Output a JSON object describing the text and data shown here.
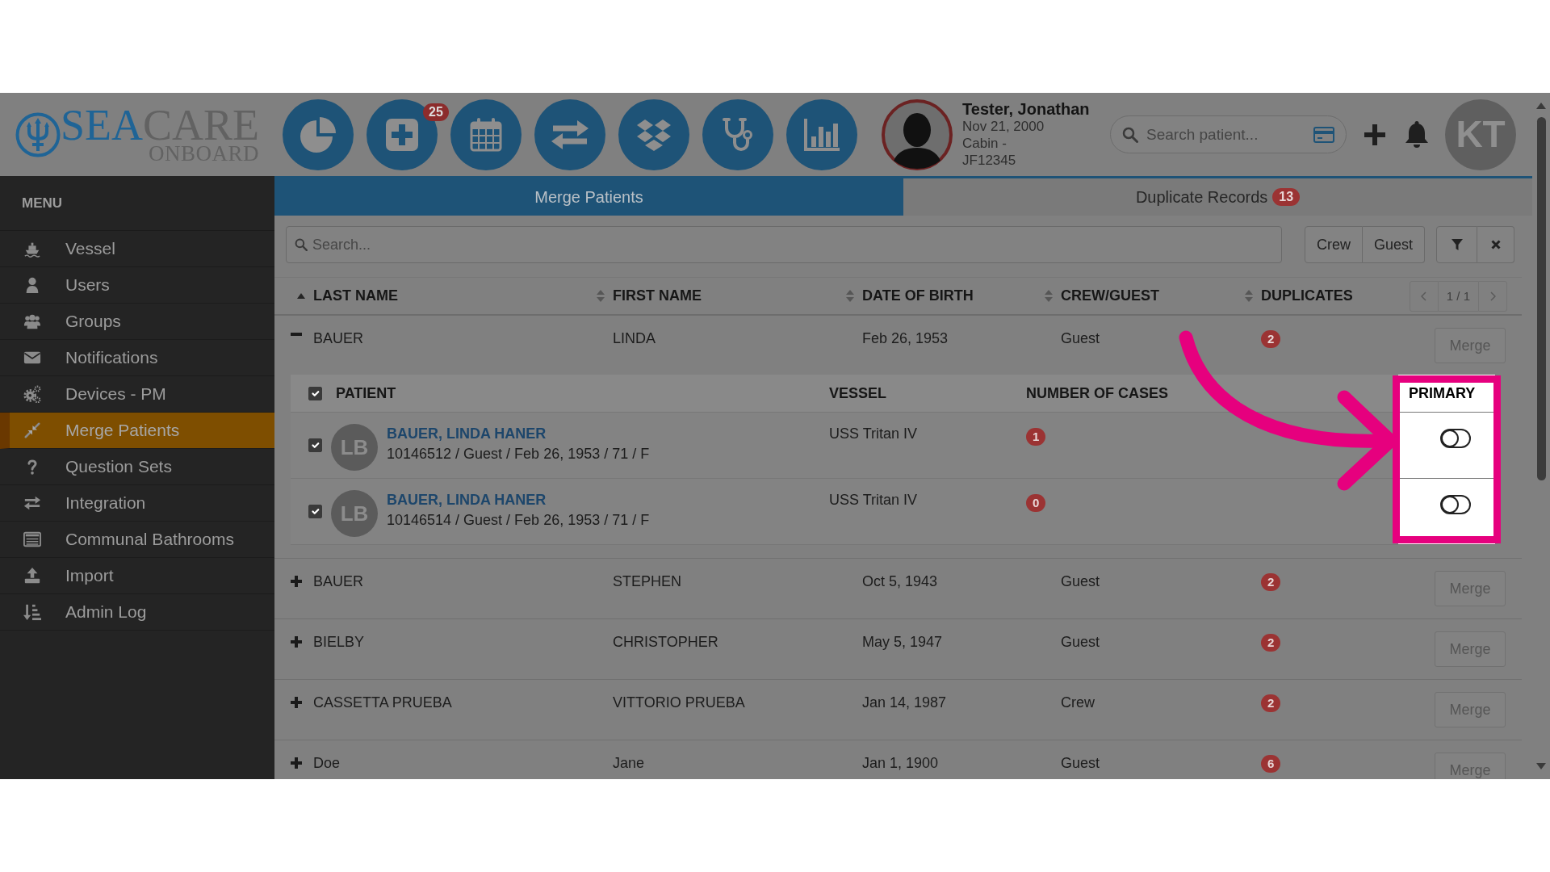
{
  "logo": {
    "parts": [
      {
        "text": "SEA",
        "color": "#1f6496"
      },
      {
        "text": "CARE",
        "color": "#626262"
      }
    ],
    "tagline": "ONBOARD"
  },
  "header": {
    "nav_badge": "25",
    "patient": {
      "name": "Tester, Jonathan",
      "dob": "Nov 21, 2000",
      "cabin": "Cabin -",
      "id": "JF12345"
    },
    "patient_search": {
      "placeholder": "Search patient..."
    },
    "user_initials": "KT"
  },
  "sidebar": {
    "title": "MENU",
    "items": [
      {
        "label": "Vessel",
        "selected": false
      },
      {
        "label": "Users",
        "selected": false
      },
      {
        "label": "Groups",
        "selected": false
      },
      {
        "label": "Notifications",
        "selected": false
      },
      {
        "label": "Devices - PM",
        "selected": false
      },
      {
        "label": "Merge Patients",
        "selected": true
      },
      {
        "label": "Question Sets",
        "selected": false
      },
      {
        "label": "Integration",
        "selected": false
      },
      {
        "label": "Communal Bathrooms",
        "selected": false
      },
      {
        "label": "Import",
        "selected": false
      },
      {
        "label": "Admin Log",
        "selected": false
      }
    ]
  },
  "tabs": [
    {
      "label": "Merge Patients",
      "selected": true
    },
    {
      "label": "Duplicate Records",
      "badge": "13",
      "selected": false
    }
  ],
  "search": {
    "placeholder": "Search..."
  },
  "filters": [
    {
      "label": "Crew",
      "selected": false
    },
    {
      "label": "Guest",
      "selected": false
    }
  ],
  "table": {
    "columns": [
      {
        "label": "LAST NAME",
        "sorted": true
      },
      {
        "label": "FIRST NAME",
        "sorted": false
      },
      {
        "label": "DATE OF BIRTH",
        "sorted": false
      },
      {
        "label": "CREW/GUEST",
        "sorted": false
      },
      {
        "label": "DUPLICATES",
        "sorted": false
      }
    ],
    "pagination": "1 / 1",
    "rows": [
      {
        "last_name": "BAUER",
        "first_name": "LINDA",
        "date_of_birth": "Feb 26, 1953",
        "crew_guest": "Guest",
        "duplicates": "2",
        "expanded": true,
        "action": "Merge",
        "details": {
          "all_checked": true,
          "columns": [
            {
              "label": "PATIENT",
              "highlighted": false
            },
            {
              "label": "VESSEL",
              "highlighted": false
            },
            {
              "label": "NUMBER OF CASES",
              "highlighted": false
            },
            {
              "label": "PRIMARY",
              "highlighted": true
            }
          ],
          "records": [
            {
              "initials": "LB",
              "name": "BAUER, LINDA HANER",
              "summary": "10146512 / Guest / Feb 26, 1953 / 71 / F",
              "vessel": "USS Tritan IV",
              "cases": "1",
              "checked": true,
              "primary": false
            },
            {
              "initials": "LB",
              "name": "BAUER, LINDA HANER",
              "summary": "10146514 / Guest / Feb 26, 1953 / 71 / F",
              "vessel": "USS Tritan IV",
              "cases": "0",
              "checked": true,
              "primary": false
            }
          ]
        }
      },
      {
        "last_name": "BAUER",
        "first_name": "STEPHEN",
        "date_of_birth": "Oct 5, 1943",
        "crew_guest": "Guest",
        "duplicates": "2",
        "expanded": false,
        "action": "Merge"
      },
      {
        "last_name": "BIELBY",
        "first_name": "CHRISTOPHER",
        "date_of_birth": "May 5, 1947",
        "crew_guest": "Guest",
        "duplicates": "2",
        "expanded": false,
        "action": "Merge"
      },
      {
        "last_name": "CASSETTA PRUEBA",
        "first_name": "VITTORIO PRUEBA",
        "date_of_birth": "Jan 14, 1987",
        "crew_guest": "Crew",
        "duplicates": "2",
        "expanded": false,
        "action": "Merge"
      },
      {
        "last_name": "Doe",
        "first_name": "Jane",
        "date_of_birth": "Jan 1, 1900",
        "crew_guest": "Guest",
        "duplicates": "6",
        "expanded": false,
        "action": "Merge"
      }
    ]
  }
}
